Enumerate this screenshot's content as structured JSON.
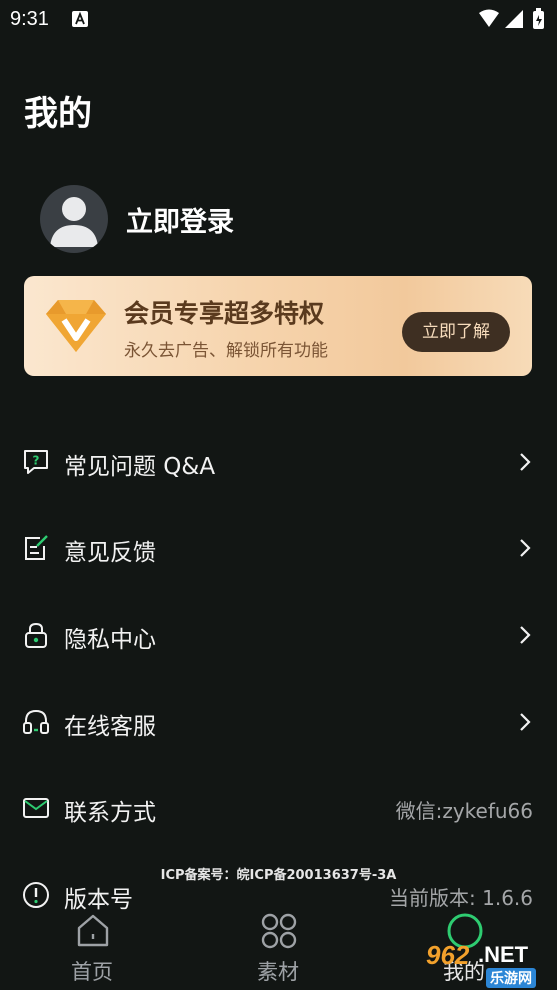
{
  "status_bar": {
    "time": "9:31"
  },
  "page": {
    "title": "我的"
  },
  "profile": {
    "login_text": "立即登录"
  },
  "vip_banner": {
    "title": "会员专享超多特权",
    "subtitle": "永久去广告、解锁所有功能",
    "button_label": "立即了解"
  },
  "menu": [
    {
      "label": "常见问题 Q&A",
      "icon": "question-chat-icon"
    },
    {
      "label": "意见反馈",
      "icon": "feedback-note-icon"
    },
    {
      "label": "隐私中心",
      "icon": "lock-icon"
    },
    {
      "label": "在线客服",
      "icon": "headset-icon"
    },
    {
      "label": "联系方式",
      "icon": "mail-icon",
      "value": "微信:zykefu66"
    },
    {
      "label": "版本号",
      "icon": "info-circle-icon",
      "value": "当前版本: 1.6.6"
    }
  ],
  "icp": "ICP备案号：皖ICP备20013637号-3A",
  "bottom_nav": [
    {
      "label": "首页",
      "icon": "home-icon"
    },
    {
      "label": "素材",
      "icon": "grid-icon"
    },
    {
      "label": "我的",
      "icon": "profile-circle-icon",
      "active": true
    }
  ],
  "watermark": {
    "number": "962",
    "suffix": ".NET",
    "site": "乐游网"
  },
  "colors": {
    "background": "#121614",
    "accent": "#2ecc71",
    "vip_button": "#3e2f22"
  }
}
